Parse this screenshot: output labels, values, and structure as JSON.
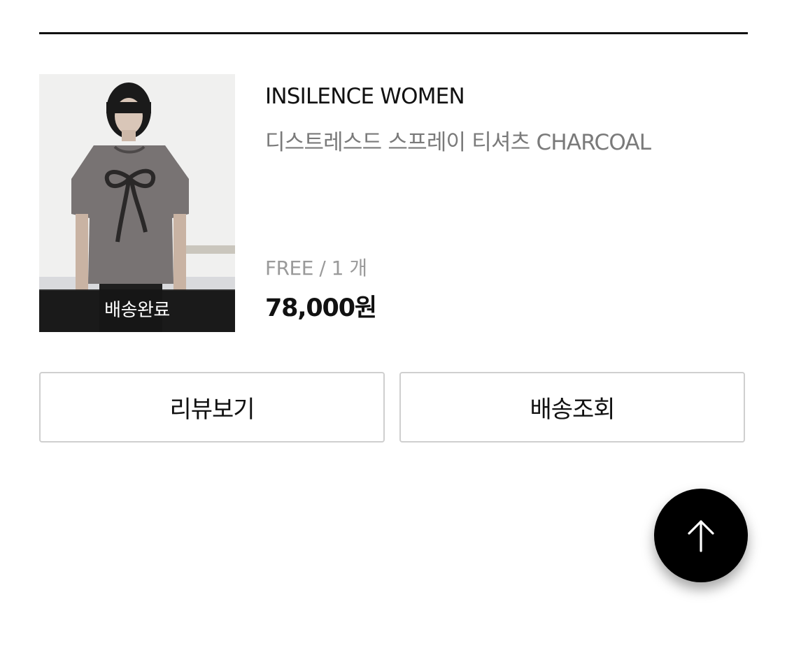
{
  "order_item": {
    "status_label": "배송완료",
    "brand": "INSILENCE WOMEN",
    "product_name": "디스트레스드 스프레이 티셔츠 CHARCOAL",
    "option": "FREE / 1 개",
    "price": "78,000원",
    "image_icon": "product-photo-tshirt"
  },
  "actions": {
    "review_label": "리뷰보기",
    "delivery_label": "배송조회"
  },
  "scroll_top": {
    "icon": "arrow-up-icon"
  },
  "colors": {
    "text_primary": "#111111",
    "text_secondary": "#7a7a7a",
    "text_muted": "#9a9a9a",
    "button_border": "#cfcfcf",
    "fab_background": "#000000"
  }
}
